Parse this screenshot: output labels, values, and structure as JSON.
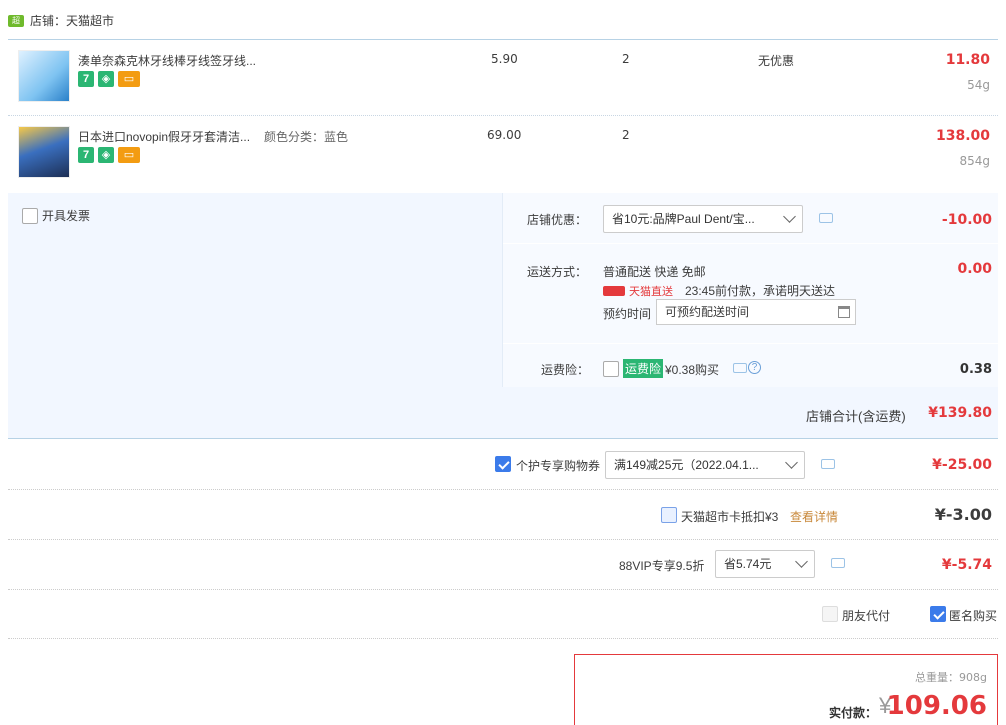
{
  "shop": {
    "label": "店铺：天猫超市"
  },
  "items": [
    {
      "title": "湊单奈森克林牙线棒牙线签牙线...",
      "sku": "",
      "price": "5.90",
      "qty": "2",
      "discount": "无优惠",
      "subtotal": "11.80",
      "weight": "54g"
    },
    {
      "title": "日本进口novopin假牙牙套清洁...",
      "sku": "颜色分类：蓝色",
      "price": "69.00",
      "qty": "2",
      "discount": "",
      "subtotal": "138.00",
      "weight": "854g"
    }
  ],
  "invoice": {
    "label": "开具发票"
  },
  "shop_coupon": {
    "label": "店铺优惠：",
    "selected": "省10元:品牌Paul Dent/宝...",
    "amount": "-10.00"
  },
  "shipping": {
    "label": "运送方式：",
    "method": "普通配送 快递 免邮",
    "tmall_tag": "天猫直送",
    "promise": "23:45前付款，承诺明天送达",
    "schedule_label": "预约时间",
    "schedule_placeholder": "可预约配送时间",
    "amount": "0.00"
  },
  "insurance": {
    "label": "运费险：",
    "tag": "运费险",
    "price_text": "¥0.38购买",
    "amount": "0.38"
  },
  "shop_total": {
    "label": "店铺合计(含运费)",
    "amount": "¥139.80"
  },
  "coupon": {
    "label": "个护专享购物券",
    "selected": "满149减25元（2022.04.1...",
    "amount": "¥-25.00"
  },
  "card": {
    "label": "天猫超市卡抵扣¥3",
    "link": "查看详情",
    "amount": "¥-3.00"
  },
  "vip": {
    "label": "88VIP专享9.5折",
    "selected": "省5.74元",
    "amount": "¥-5.74"
  },
  "options": {
    "friend_pay": "朋友代付",
    "anonymous": "匿名购买"
  },
  "total": {
    "weight_label": "总重量：",
    "weight": "908g",
    "pay_label": "实付款：",
    "currency": "¥",
    "amount": "109.06"
  },
  "colors": {
    "accent": "#e4393c",
    "panel": "#f2f7ff",
    "check": "#3b7bea"
  }
}
